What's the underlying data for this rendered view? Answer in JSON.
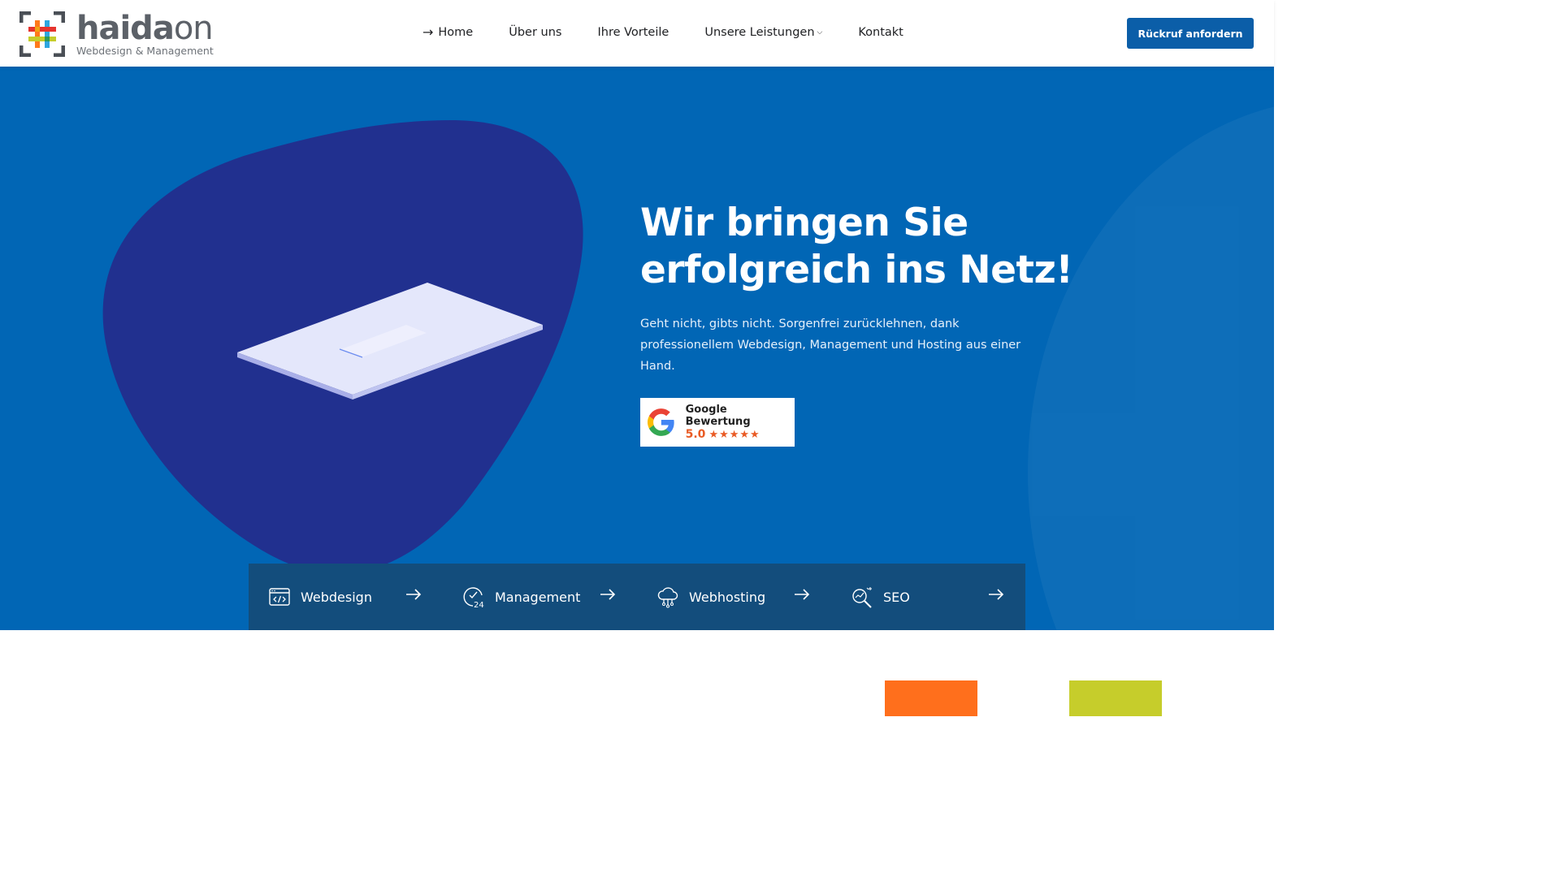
{
  "header": {
    "logo": {
      "word_main": "haida",
      "word_accent": "on",
      "tagline": "Webdesign & Management"
    },
    "nav": [
      {
        "label": "Home",
        "icon": "arrow-right-icon",
        "active": true
      },
      {
        "label": "Über uns"
      },
      {
        "label": "Ihre Vorteile"
      },
      {
        "label": "Unsere Leistungen",
        "icon": "chevron-down-icon"
      },
      {
        "label": "Kontakt"
      }
    ],
    "cta_label": "Rückruf anfordern"
  },
  "hero": {
    "title_line1": "Wir bringen Sie",
    "title_line2": "erfolgreich ins Netz!",
    "text": "Geht nicht, gibts nicht. Sorgenfrei zurücklehnen, dank professionellem Webdesign, Management und Hosting aus einer Hand.",
    "badge": {
      "title": "Google Bewertung",
      "rating": "5.0",
      "stars": "★★★★★"
    }
  },
  "services": [
    {
      "label": "Webdesign",
      "icon": "code-window-icon"
    },
    {
      "label": "Management",
      "icon": "clock-24-icon"
    },
    {
      "label": "Webhosting",
      "icon": "cloud-network-icon"
    },
    {
      "label": "SEO",
      "icon": "magnifier-search-icon"
    }
  ],
  "colors": {
    "hero_bg": "#0166b5",
    "blob": "#21308f",
    "services_bg": "#134d7c",
    "cta_bg": "#0b5ea8",
    "accent_orange": "#ff6f1c",
    "accent_lime": "#c6cd2b",
    "rating": "#e95b25"
  }
}
